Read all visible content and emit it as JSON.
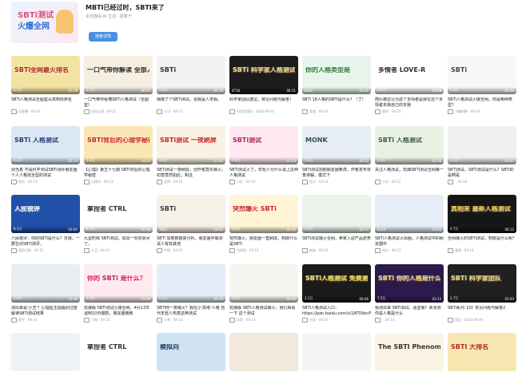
{
  "header": {
    "cover_line1": "SBTi测试",
    "cover_line2": "火爆全网",
    "title": "MBTI已经过时，SBTI来了",
    "subtitle": "本页面由 AI 生成 · 更新于",
    "button_label": "搜索详情"
  },
  "rows": [
    [
      {
        "thumb_text": "SBTi全网最火排名",
        "bg": "#f3e3a3",
        "fg": "#b3261e",
        "views": "5.3万",
        "duration": "01:28",
        "title": "SBTi人格测试全图鉴从高到低排名",
        "author": "吕智慧",
        "date": "04-10"
      },
      {
        "thumb_text": "一口气带你解读 全部人格",
        "bg": "#f6efe1",
        "fg": "#2b2b2b",
        "views": "3.1万",
        "duration": "08:42",
        "title": "一口气带你看懂SBTi人格测试（全图鉴）",
        "author": "自在心理",
        "date": "04-12"
      },
      {
        "thumb_text": "SBTi",
        "bg": "#f2f2f2",
        "fg": "#333333",
        "views": "1.2万",
        "duration": "02:10",
        "title": "我做了个SBTi测试，说我是人末我。",
        "author": "小可",
        "date": "04-11"
      },
      {
        "thumb_text": "SBTi 科学家人格测试 Q&A",
        "bg": "#1c1c1c",
        "fg": "#f3d27a",
        "views": "4716",
        "duration": "06:31",
        "title": "科学家团队建议，常见问题与解答！",
        "author": "科学家团队",
        "date": "2024-04-02"
      },
      {
        "thumb_text": "你的人格类型是",
        "bg": "#e8f4ec",
        "fg": "#2e7d32",
        "views": "8564",
        "duration": "01:11",
        "title": "SBTi 16人格的SBTi是什么？（了）",
        "author": "我就",
        "date": "04-13"
      },
      {
        "thumb_text": "多情者 LOVE-R",
        "bg": "#ffffff",
        "fg": "#333333",
        "views": "2.6万",
        "duration": "00:58",
        "title": "简历被这以为这个多情者是我在这个多情者本我自己的本我",
        "author": "简约",
        "date": "04-15"
      },
      {
        "thumb_text": "SBTi",
        "bg": "#f7f7f7",
        "fg": "#444444",
        "views": "1.8万",
        "duration": "03:20",
        "title": "SBTi人格测试火爆全网，你是哪种类型？",
        "author": "大趣的数",
        "date": "04-10"
      }
    ],
    [
      {
        "thumb_text": "SBTi 人格测试",
        "bg": "#dbe7f5",
        "fg": "#1f3b70",
        "views": "6.2万",
        "duration": "05:14",
        "title": "别当真 不是科学测试SBTi测评朋友圈个人人格完全型的测试",
        "author": "快乐",
        "date": "04-14"
      },
      {
        "thumb_text": "SBTi背后的心理学秘密",
        "bg": "#fbe7b5",
        "fg": "#c62828",
        "views": "1.1万",
        "duration": "04:02",
        "title": "【心理】第五十七期 SBTi背后的心理学秘密",
        "author": "心理学",
        "date": "04-13"
      },
      {
        "thumb_text": "SBTi测试 一夜刷屏",
        "bg": "#f9f2e3",
        "fg": "#c62828",
        "views": "3.4万",
        "duration": "07:45",
        "title": "SBTi测试一夜刷屏，创作者竟失爆火，初衷竟然如此，和这",
        "author": "全网",
        "date": "04-15"
      },
      {
        "thumb_text": "SBTi测试",
        "bg": "#fde9ef",
        "fg": "#b0245a",
        "views": "9.8万",
        "duration": "07:23",
        "title": "SBTi测试火了，年轻人为什么谈上这种人格测试",
        "author": "小红",
        "date": "04-16"
      },
      {
        "thumb_text": "MONK",
        "bg": "#e6edf3",
        "fg": "#2f4f4f",
        "views": "5,1万",
        "duration": "04:11",
        "title": "SBTi测试加剧朋友圈焦虑，作者发布背景讲解，模式下",
        "author": "官方",
        "date": "04-13"
      },
      {
        "thumb_text": "SBTi 人格测试",
        "bg": "#e9f1e3",
        "fg": "#355e3b",
        "views": "1.4万",
        "duration": "02:56",
        "title": "关注人格测试，玩爆SBTi测试全网第一",
        "author": "小乐",
        "date": "04-12"
      },
      {
        "thumb_text": "",
        "bg": "#eef0f2",
        "fg": "#333333",
        "views": "1.1万",
        "duration": "01:47",
        "title": "SBTi测试，SBTi测试是什么？SBTi的是啊是",
        "author": "",
        "date": "04-16"
      }
    ],
    [
      {
        "thumb_text": "人民锐评",
        "bg": "#2050a8",
        "fg": "#ffffff",
        "views": "8.3万",
        "duration": "03:02",
        "title": "人民锐评：你的SBTi是什么？日报，一群在对SBTi测评，",
        "author": "国民日报",
        "date": "04-15"
      },
      {
        "thumb_text": "拿捏者 CTRL",
        "bg": "#ffffff",
        "fg": "#333333",
        "views": "2.2万",
        "duration": "02:38",
        "title": "九型时候 SBTi测试，说出一份实际问了，",
        "author": "九品",
        "date": "04-15"
      },
      {
        "thumb_text": "SBTi",
        "bg": "#f6f1e7",
        "fg": "#3a3a3a",
        "views": "7862",
        "duration": "10:21",
        "title": "SBTi 加到数据来分析，朋友圈中做测试人有效其他",
        "author": "中国",
        "date": "04-12"
      },
      {
        "thumb_text": "突然爆火 SBTi",
        "bg": "#fff5d6",
        "fg": "#c62828",
        "views": "2.9万",
        "duration": "05:06",
        "title": "突然爆火，朋友圈一直刷屏，到底什么是SBTi",
        "author": "光明网",
        "date": "04-13"
      },
      {
        "thumb_text": "",
        "bg": "#eaf2ea",
        "fg": "#333333",
        "views": "1.6万",
        "duration": "02:17",
        "title": "SBTi测试爆火全网，卖家入驻产品走势",
        "author": "新闻",
        "date": "04-16"
      },
      {
        "thumb_text": "",
        "bg": "#e5eef7",
        "fg": "#1f3b70",
        "views": "6240",
        "duration": "03:55",
        "title": "SBTi人格测试火出圈，人格测试中的朋友圈中",
        "author": "热点",
        "date": "04-11"
      },
      {
        "thumb_text": "真相来 最新人格测试",
        "bg": "#161616",
        "fg": "#f2c94c",
        "views": "4.7万",
        "duration": "06:12",
        "title": "全网爆火的SBTi测试，到底是什么呢？",
        "author": "真相",
        "date": "04-14"
      }
    ],
    [
      {
        "thumb_text": "",
        "bg": "#e9eef2",
        "fg": "#333333",
        "views": "3.6万",
        "duration": "12:30",
        "title": "测出来是'小丑'？心理医生提醒别过度解读SBTi测试结果",
        "author": "医生",
        "date": "04-14"
      },
      {
        "thumb_text": "你的 SBTi 是什么？",
        "bg": "#fdecef",
        "fg": "#d81b60",
        "views": "1.9万",
        "duration": "01:59",
        "title": "玩爆版 SBTi测试火爆全网，4月13日谈到10日爆款，朋友圈被刷",
        "author": "小鱼",
        "date": "04-15"
      },
      {
        "thumb_text": "",
        "bg": "#e3ecf8",
        "fg": "#1f3b70",
        "views": "5.2万",
        "duration": "02:44",
        "title": "SBTi何一夜爆火？我在小'高考'人格 自代年轻人热衷这种测试",
        "author": "人物",
        "date": "04-13"
      },
      {
        "thumb_text": "",
        "bg": "#f6f6f0",
        "fg": "#333333",
        "views": "2.3万",
        "duration": "04:40",
        "title": "玩爆版 SBTi人格测试爆火，我们来看一下 这个测试",
        "author": "玩家",
        "date": "04-13"
      },
      {
        "thumb_text": "SBTi人格测试 免费测试入口",
        "bg": "#1b1b1b",
        "fg": "#ffe14d",
        "views": "3.1万",
        "duration": "00:46",
        "title": "SBTi人格测试入口：https://pan.baidu.com/s/1ATOVecPtrfwk",
        "author": "分享",
        "date": "04-16"
      },
      {
        "thumb_text": "SBTi 你的人格是什么",
        "bg": "#2b1a4a",
        "fg": "#f6d36b",
        "views": "7.5万",
        "duration": "03:33",
        "title": "我测出来 SBTi测试，适宜做？来测测你是人格是什么",
        "author": "",
        "date": "04-14"
      },
      {
        "thumb_text": "SBTi 科学家团队",
        "bg": "#202020",
        "fg": "#f3d27a",
        "views": "2.7万",
        "duration": "02:03",
        "title": "SBTi系列【3】常见问题与解答2",
        "author": "团队",
        "date": "2024-04-09"
      }
    ],
    [
      {
        "thumb_text": "",
        "bg": "#eef3f7",
        "fg": "#333333",
        "views": "",
        "duration": "",
        "title": "",
        "author": "",
        "date": ""
      },
      {
        "thumb_text": "拿捏者 CTRL",
        "bg": "#ffffff",
        "fg": "#333333",
        "views": "",
        "duration": "",
        "title": "",
        "author": "",
        "date": ""
      },
      {
        "thumb_text": "模拟向",
        "bg": "#cfe3f3",
        "fg": "#1f3b70",
        "views": "",
        "duration": "",
        "title": "",
        "author": "",
        "date": ""
      },
      {
        "thumb_text": "",
        "bg": "#f1e9dc",
        "fg": "#333333",
        "views": "",
        "duration": "",
        "title": "",
        "author": "",
        "date": ""
      },
      {
        "thumb_text": "",
        "bg": "#f5f5f5",
        "fg": "#333333",
        "views": "",
        "duration": "",
        "title": "",
        "author": "",
        "date": ""
      },
      {
        "thumb_text": "The SBTI Phenomenon",
        "bg": "#fbf3e3",
        "fg": "#333333",
        "views": "",
        "duration": "",
        "title": "",
        "author": "",
        "date": ""
      },
      {
        "thumb_text": "SBTI 大排名",
        "bg": "#f7e7b0",
        "fg": "#b3261e",
        "views": "",
        "duration": "",
        "title": "",
        "author": "",
        "date": ""
      }
    ]
  ]
}
